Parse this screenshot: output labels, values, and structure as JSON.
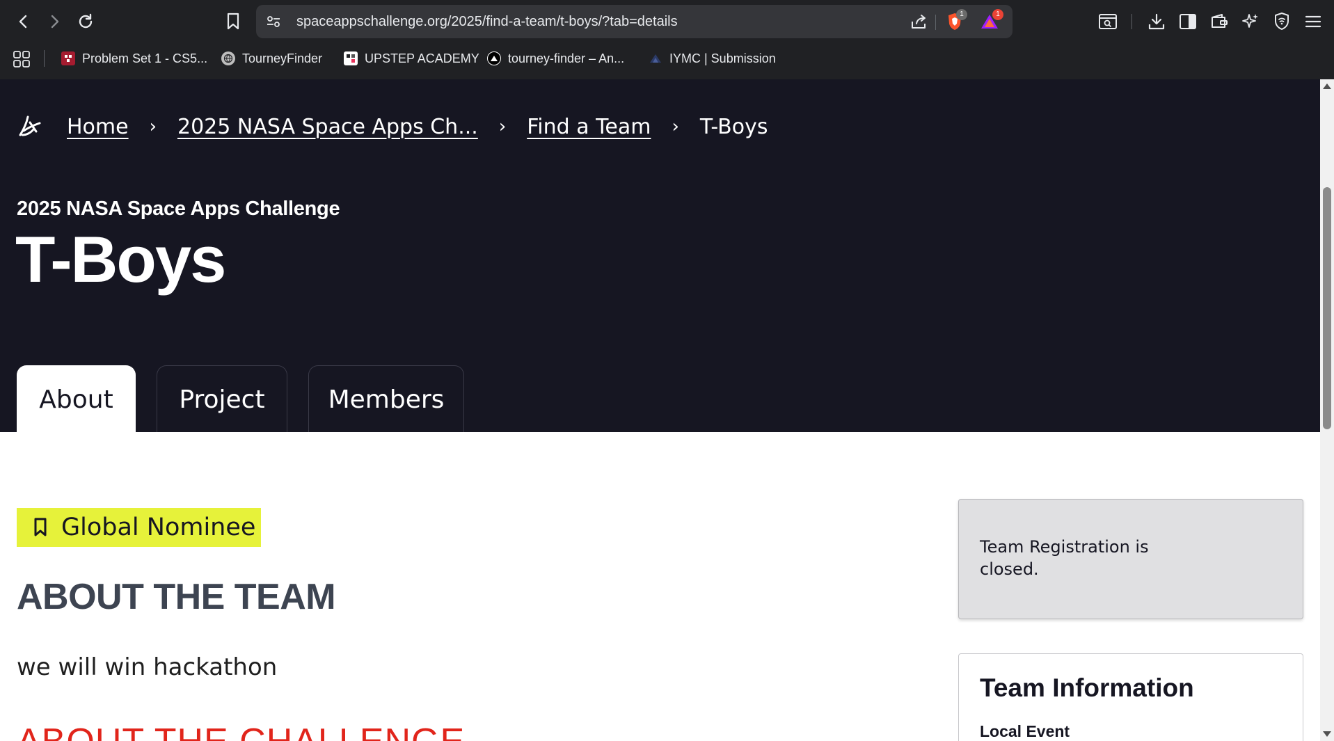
{
  "browser": {
    "url": "spaceappschallenge.org/2025/find-a-team/t-boys/?tab=details",
    "brave_shield_count": "1",
    "rewards_count": "1",
    "bookmarks": [
      {
        "label": "Problem Set 1 - CS5...",
        "icon": "harvard-shield-icon",
        "color": "#a51c30"
      },
      {
        "label": "TourneyFinder",
        "icon": "globe-icon",
        "color": "#bdbdbd"
      },
      {
        "label": "UPSTEP ACADEMY",
        "icon": "upstep-icon",
        "color": "#ffffff"
      },
      {
        "label": "tourney-finder – An...",
        "icon": "triangle-icon",
        "color": "#000000"
      },
      {
        "label": "IYMC | Submission",
        "icon": "iymc-icon",
        "color": "#3a4a7a"
      }
    ]
  },
  "breadcrumb": {
    "items": [
      "Home",
      "2025 NASA Space Apps Ch...",
      "Find a Team"
    ],
    "current": "T-Boys",
    "separator": "›"
  },
  "hero": {
    "subtitle": "2025 NASA Space Apps Challenge",
    "title": "T-Boys"
  },
  "tabs": [
    {
      "label": "About",
      "active": true
    },
    {
      "label": "Project",
      "active": false
    },
    {
      "label": "Members",
      "active": false
    }
  ],
  "main": {
    "nominee_badge": "Global Nominee",
    "about_team_heading": "ABOUT THE TEAM",
    "about_team_text": "we will win hackathon",
    "about_challenge_heading": "ABOUT THE CHALLENGE"
  },
  "sidebar": {
    "registration_text": "Team Registration is closed.",
    "info_title": "Team Information",
    "info_local_event_label": "Local Event"
  },
  "colors": {
    "hero_bg": "#161622",
    "badge_yellow": "#e6f23a",
    "challenge_red": "#e1251b",
    "heading_gray": "#3d4451"
  }
}
